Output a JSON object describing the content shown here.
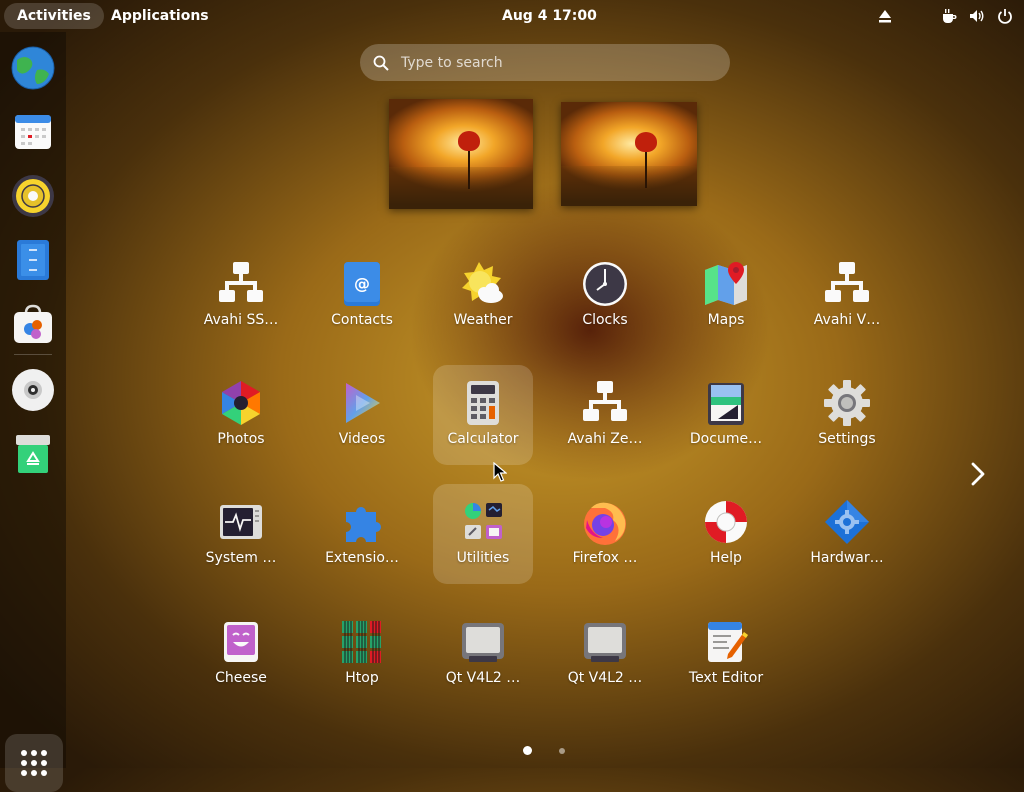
{
  "topbar": {
    "activities_label": "Activities",
    "applications_label": "Applications",
    "clock": "Aug 4  17:00",
    "tray_icons": [
      "eject-icon",
      "coffee-icon",
      "volume-icon",
      "power-icon"
    ]
  },
  "dash": {
    "items": [
      "web-browser-icon",
      "calendar-icon",
      "rhythmbox-icon",
      "text-document-icon",
      "software-center-icon",
      "disc-icon",
      "trash-icon"
    ],
    "show_apps_icon": "grid-icon"
  },
  "search": {
    "placeholder": "Type to search"
  },
  "apps": [
    {
      "label": "Avahi SS…",
      "icon": "network-icon"
    },
    {
      "label": "Contacts",
      "icon": "contacts-icon"
    },
    {
      "label": "Weather",
      "icon": "weather-icon"
    },
    {
      "label": "Clocks",
      "icon": "clock-icon"
    },
    {
      "label": "Maps",
      "icon": "maps-icon"
    },
    {
      "label": "Avahi V…",
      "icon": "network-icon"
    },
    {
      "label": "Photos",
      "icon": "photos-icon"
    },
    {
      "label": "Videos",
      "icon": "videos-icon"
    },
    {
      "label": "Calculator",
      "icon": "calculator-icon"
    },
    {
      "label": "Avahi Ze…",
      "icon": "network-icon"
    },
    {
      "label": "Docume…",
      "icon": "document-viewer-icon"
    },
    {
      "label": "Settings",
      "icon": "settings-gear-icon"
    },
    {
      "label": "System …",
      "icon": "system-monitor-icon"
    },
    {
      "label": "Extensio…",
      "icon": "extensions-icon"
    },
    {
      "label": "Utilities",
      "icon": "folder-grid-icon"
    },
    {
      "label": "Firefox …",
      "icon": "firefox-icon"
    },
    {
      "label": "Help",
      "icon": "help-lifebuoy-icon"
    },
    {
      "label": "Hardwar…",
      "icon": "hardware-icon"
    },
    {
      "label": "Cheese",
      "icon": "cheese-icon"
    },
    {
      "label": "Htop",
      "icon": "htop-icon"
    },
    {
      "label": "Qt V4L2 …",
      "icon": "webcam-icon"
    },
    {
      "label": "Qt V4L2 …",
      "icon": "webcam-icon"
    },
    {
      "label": "Text Editor",
      "icon": "text-editor-icon"
    }
  ],
  "pagination": {
    "pages": 2,
    "current": 1
  },
  "colors": {
    "background": "#a0701c",
    "accent_red": "#e01b24",
    "firefox_orange": "#ff7139"
  }
}
